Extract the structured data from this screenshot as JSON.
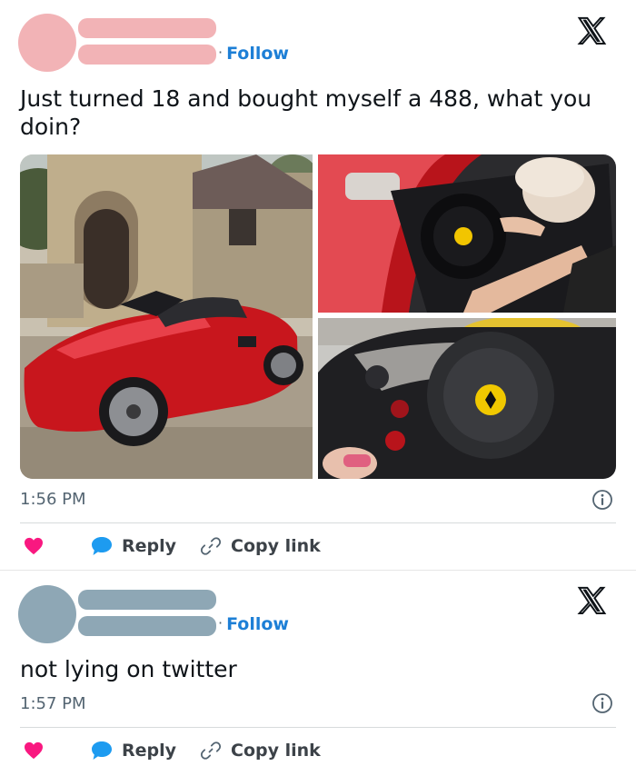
{
  "tweets": [
    {
      "avatar_color": "#f2b3b6",
      "name_bar_color": "#f2b3b6",
      "follow_label": "Follow",
      "follow_separator": "·",
      "text_line1": "Just turned 18 and bought myself a 488, what you",
      "text_line2": "doin?",
      "time": "1:56 PM",
      "reply_label": "Reply",
      "copy_link_label": "Copy link"
    },
    {
      "avatar_color": "#8ea7b5",
      "name_bar_color": "#8ea7b5",
      "follow_label": "Follow",
      "follow_separator": "·",
      "text_line1": "not lying on twitter",
      "time": "1:57 PM",
      "reply_label": "Reply",
      "copy_link_label": "Copy link"
    }
  ],
  "colors": {
    "follow": "#1d7fd6",
    "heart": "#f91880",
    "reply_bubble": "#1d9bf0",
    "muted": "#536471"
  },
  "icons": [
    "x-logo-icon",
    "info-icon",
    "heart-icon",
    "reply-bubble-icon",
    "link-icon"
  ]
}
